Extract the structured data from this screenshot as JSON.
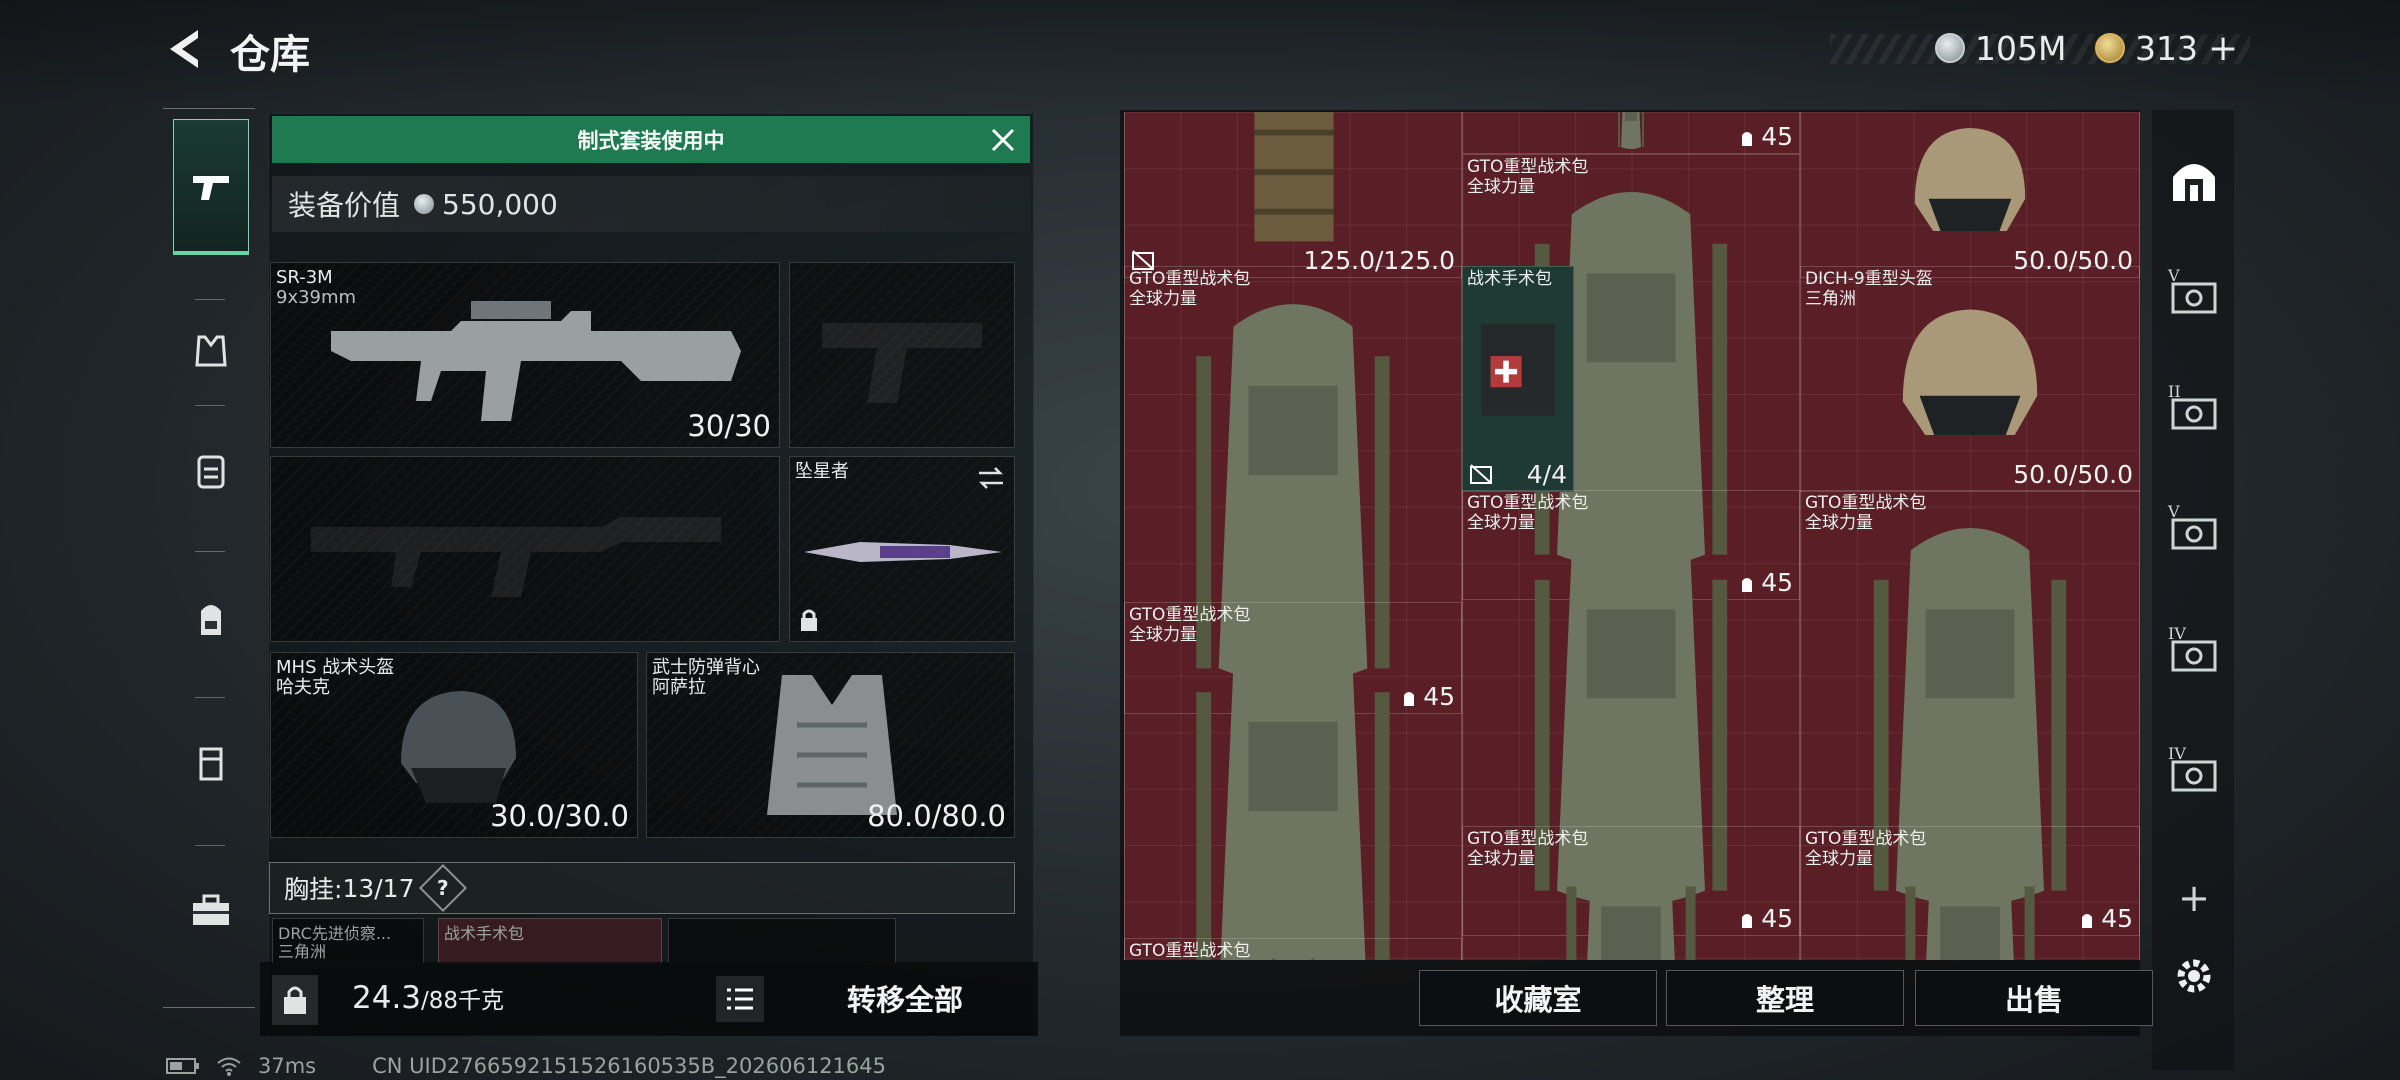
{
  "header": {
    "title": "仓库",
    "currency_silver": "105M",
    "currency_gold": "313",
    "gold_add": "+"
  },
  "rail": {
    "items": [
      "weapon",
      "backpack-armor",
      "armor",
      "backpack",
      "chest-rig",
      "toolbox"
    ]
  },
  "loadout": {
    "banner": "制式套装使用中",
    "value_label": "装备价值",
    "value": "550,000",
    "primary": {
      "name": "SR-3M",
      "caliber": "9x39mm",
      "durability": "30/30"
    },
    "melee": {
      "name": "坠星者"
    },
    "helmet": {
      "name": "MHS 战术头盔",
      "sub": "哈夫克",
      "durability": "30.0/30.0"
    },
    "armor": {
      "name": "武士防弹背心",
      "sub": "阿萨拉",
      "durability": "80.0/80.0"
    },
    "chest": {
      "label": "胸挂:",
      "value": "13/17",
      "help": "?"
    },
    "chest_items": [
      {
        "name": "DRC先进侦察...",
        "sub": "三角洲"
      },
      {
        "name": "战术手术包",
        "sub": ""
      }
    ],
    "weight": "24.3",
    "weight_max": "/88千克",
    "transfer": "转移全部"
  },
  "storage": {
    "items": [
      {
        "name": "",
        "sub": "",
        "count": "125.0/125.0",
        "type": "vest"
      },
      {
        "name": "",
        "sub": "",
        "count": "45",
        "type": "bag"
      },
      {
        "name": "",
        "sub": "",
        "count": "50.0/50.0",
        "type": "helmet"
      },
      {
        "name": "GTO重型战术包",
        "sub": "全球力量",
        "count": "45",
        "type": "bag"
      },
      {
        "name": "GTO重型战术包",
        "sub": "全球力量",
        "count": "45",
        "type": "bag"
      },
      {
        "name": "战术手术包",
        "sub": "",
        "count": "4/4",
        "type": "med"
      },
      {
        "name": "DICH-9重型头盔",
        "sub": "三角洲",
        "count": "50.0/50.0",
        "type": "helmet"
      },
      {
        "name": "GTO重型战术包",
        "sub": "全球力量",
        "count": "45",
        "type": "bag"
      },
      {
        "name": "GTO重型战术包",
        "sub": "全球力量",
        "count": "45",
        "type": "bag"
      },
      {
        "name": "GTO重型战术包",
        "sub": "全球力量",
        "count": "45",
        "type": "bag"
      },
      {
        "name": "GTO重型战术包",
        "sub": "全球力量",
        "count": "",
        "type": "bag"
      },
      {
        "name": "GTO重型战术包",
        "sub": "全球力量",
        "count": "",
        "type": "bag"
      },
      {
        "name": "GTO重型战术包",
        "sub": "",
        "count": "",
        "type": "bag"
      }
    ],
    "side_labels": [
      "V",
      "II",
      "V",
      "IV",
      "IV"
    ],
    "add": "+",
    "actions": {
      "collection": "收藏室",
      "sort": "整理",
      "sell": "出售"
    }
  },
  "status": {
    "ping": "37ms",
    "uid": "CN UID2766592151526160535B_202606121645"
  },
  "colors": {
    "accent": "#1f7a52",
    "grid": "#5a1f26",
    "teal": "#63d6a3"
  }
}
